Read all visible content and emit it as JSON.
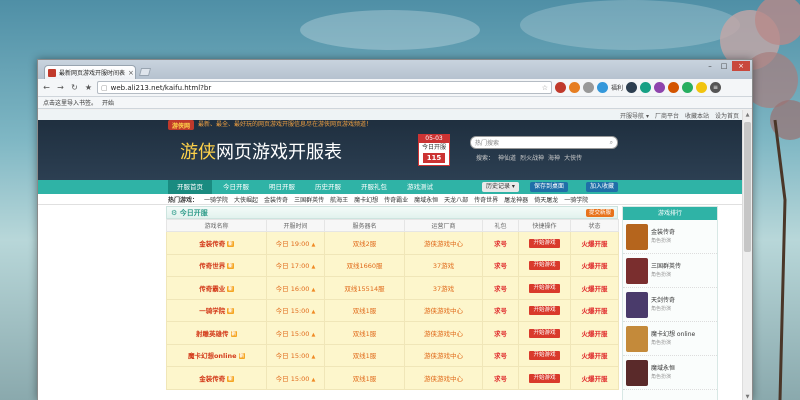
{
  "browser": {
    "tab_title": "最新网页游戏开服时间表",
    "tab_close": "×",
    "window_controls": [
      "–",
      "□",
      "×"
    ],
    "url": "web.ali213.net/kaifu.html?br",
    "extensions": [
      "福利"
    ],
    "bookmarks": [
      "点击这里导入书签。",
      "开始"
    ]
  },
  "page": {
    "topstrip_links": [
      "开服导航 ▾",
      "厂商平台",
      "收藏本站",
      "设为首页"
    ],
    "header": {
      "logo_small": "游侠网",
      "slogan": "最新、最全、最好玩的网页游戏开服信息尽在游侠网页游戏频道！",
      "title_highlight": "游侠",
      "title_rest": "网页游戏开服表",
      "date_top": "05-03",
      "date_mid": "今日开服",
      "date_num": "115",
      "search_placeholder": "热门搜索",
      "search_icon": "search-icon",
      "hot_words": [
        "搜索：",
        "神仙道",
        "烈火战神",
        "海神",
        "大侠传"
      ]
    },
    "nav": {
      "items": [
        "开服首页",
        "今日开服",
        "明日开服",
        "历史开服",
        "开服礼包",
        "游戏测试"
      ],
      "history_btn": "历史记录 ▾",
      "save_btn": "保存到桌面",
      "fav_btn": "加入收藏"
    },
    "hot_games": {
      "label": "热门游戏：",
      "items": [
        "一骑学院",
        "大侠崛起",
        "金装传奇",
        "三国群英传",
        "航海王",
        "魔卡幻想",
        "传奇霸业",
        "魔域永恒",
        "天龙八部",
        "传奇世界",
        "屠龙神器",
        "倚天屠龙",
        "一骑学院"
      ]
    },
    "today": {
      "title": "今日开服",
      "submit": "提交新服",
      "headers": [
        "游戏名称",
        "开服时间",
        "服务器名",
        "运营厂商",
        "礼包",
        "快捷操作",
        "状态"
      ],
      "rows": [
        {
          "game": "金装传奇",
          "time": "今日 19:00",
          "server": "双线2服",
          "op": "游侠游戏中心",
          "gift": "求号",
          "action": "开始游戏",
          "state": "火爆开服"
        },
        {
          "game": "传奇世界",
          "time": "今日 17:00",
          "server": "双线1660服",
          "op": "37游戏",
          "gift": "求号",
          "action": "开始游戏",
          "state": "火爆开服"
        },
        {
          "game": "传奇霸业",
          "time": "今日 16:00",
          "server": "双线15514服",
          "op": "37游戏",
          "gift": "求号",
          "action": "开始游戏",
          "state": "火爆开服"
        },
        {
          "game": "一骑学院",
          "time": "今日 15:00",
          "server": "双线1服",
          "op": "游侠游戏中心",
          "gift": "求号",
          "action": "开始游戏",
          "state": "火爆开服"
        },
        {
          "game": "射雕英雄传",
          "time": "今日 15:00",
          "server": "双线1服",
          "op": "游侠游戏中心",
          "gift": "求号",
          "action": "开始游戏",
          "state": "火爆开服"
        },
        {
          "game": "魔卡幻想online",
          "time": "今日 15:00",
          "server": "双线1服",
          "op": "游侠游戏中心",
          "gift": "求号",
          "action": "开始游戏",
          "state": "火爆开服"
        },
        {
          "game": "金装传奇",
          "time": "今日 15:00",
          "server": "双线1服",
          "op": "游侠游戏中心",
          "gift": "求号",
          "action": "开始游戏",
          "state": "火爆开服"
        }
      ]
    },
    "sidebar": {
      "title": "游戏排行",
      "items": [
        {
          "name": "金装传奇",
          "sub": "角色扮演",
          "color": "#b5651d"
        },
        {
          "name": "三国群英传",
          "sub": "角色扮演",
          "color": "#7a2e2e"
        },
        {
          "name": "天剑传奇",
          "sub": "角色扮演",
          "color": "#4a3b6b"
        },
        {
          "name": "魔卡幻想 online",
          "sub": "角色扮演",
          "color": "#c48a3a"
        },
        {
          "name": "魔域永恒",
          "sub": "角色扮演",
          "color": "#5a2a2a"
        }
      ]
    }
  }
}
